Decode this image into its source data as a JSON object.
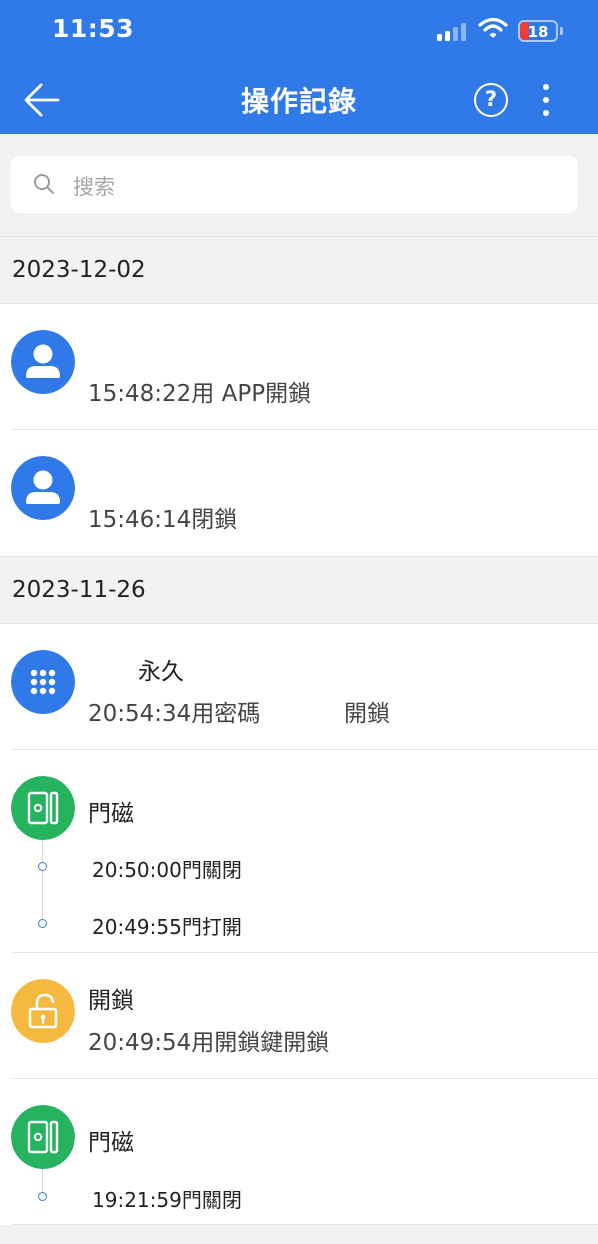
{
  "status_bar": {
    "time": "11:53",
    "battery": "18"
  },
  "header": {
    "title": "操作記錄",
    "help_label": "?"
  },
  "search": {
    "placeholder": "搜索"
  },
  "colors": {
    "primary": "#2f7ae8",
    "door_sensor": "#26b35f",
    "unlock_key": "#f6b940"
  },
  "groups": [
    {
      "date": "2023-12-02",
      "records": [
        {
          "icon": "user-icon",
          "title": "",
          "detail": "15:48:22用 APP開鎖"
        },
        {
          "icon": "user-icon",
          "title": "",
          "detail": "15:46:14閉鎖"
        }
      ]
    },
    {
      "date": "2023-11-26",
      "records": [
        {
          "icon": "keypad-icon",
          "title": "永久",
          "detail": "20:54:34用密碼",
          "detail_suffix": "開鎖"
        },
        {
          "icon": "door-sensor-icon",
          "title": "門磁",
          "events": [
            "20:50:00門關閉",
            "20:49:55門打開"
          ]
        },
        {
          "icon": "unlock-icon",
          "title": "開鎖",
          "detail": "20:49:54用開鎖鍵開鎖"
        },
        {
          "icon": "door-sensor-icon",
          "title": "門磁",
          "events": [
            "19:21:59門關閉"
          ]
        }
      ]
    }
  ]
}
